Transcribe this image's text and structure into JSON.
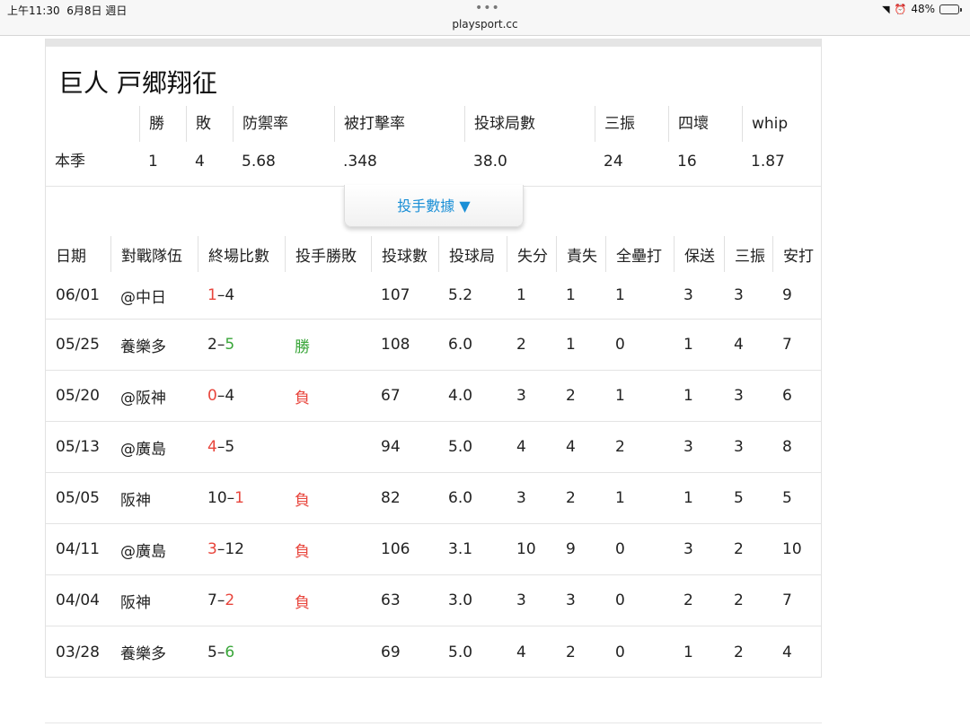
{
  "status_bar": {
    "time": "上午11:30",
    "date": "6月8日 週日",
    "url": "playsport.cc",
    "battery": "48%",
    "battery_level": 0.48
  },
  "player": {
    "title": "巨人 戸郷翔征"
  },
  "season": {
    "headers": [
      "",
      "勝",
      "敗",
      "防禦率",
      "被打擊率",
      "投球局數",
      "三振",
      "四壞",
      "whip"
    ],
    "row": [
      "本季",
      "1",
      "4",
      "5.68",
      ".348",
      "38.0",
      "24",
      "16",
      "1.87"
    ]
  },
  "toggle": {
    "label": "投手數據 ▼"
  },
  "games": {
    "headers": [
      "日期",
      "對戰隊伍",
      "終場比數",
      "投手勝敗",
      "投球數",
      "投球局",
      "失分",
      "責失",
      "全壘打",
      "保送",
      "三振",
      "安打"
    ],
    "rows": [
      {
        "date": "06/01",
        "opp": "@中日",
        "s1": "1",
        "s1c": "red",
        "s2": "4",
        "s2c": "",
        "wl": "",
        "wlc": "",
        "pitches": "107",
        "ip": "5.2",
        "r": "1",
        "er": "1",
        "hr": "1",
        "bb": "3",
        "so": "3",
        "h": "9"
      },
      {
        "date": "05/25",
        "opp": "養樂多",
        "s1": "2",
        "s1c": "",
        "s2": "5",
        "s2c": "green",
        "wl": "勝",
        "wlc": "green",
        "pitches": "108",
        "ip": "6.0",
        "r": "2",
        "er": "1",
        "hr": "0",
        "bb": "1",
        "so": "4",
        "h": "7"
      },
      {
        "date": "05/20",
        "opp": "@阪神",
        "s1": "0",
        "s1c": "red",
        "s2": "4",
        "s2c": "",
        "wl": "負",
        "wlc": "red",
        "pitches": "67",
        "ip": "4.0",
        "r": "3",
        "er": "2",
        "hr": "1",
        "bb": "1",
        "so": "3",
        "h": "6"
      },
      {
        "date": "05/13",
        "opp": "@廣島",
        "s1": "4",
        "s1c": "red",
        "s2": "5",
        "s2c": "",
        "wl": "",
        "wlc": "",
        "pitches": "94",
        "ip": "5.0",
        "r": "4",
        "er": "4",
        "hr": "2",
        "bb": "3",
        "so": "3",
        "h": "8"
      },
      {
        "date": "05/05",
        "opp": "阪神",
        "s1": "10",
        "s1c": "",
        "s2": "1",
        "s2c": "red",
        "wl": "負",
        "wlc": "red",
        "pitches": "82",
        "ip": "6.0",
        "r": "3",
        "er": "2",
        "hr": "1",
        "bb": "1",
        "so": "5",
        "h": "5"
      },
      {
        "date": "04/11",
        "opp": "@廣島",
        "s1": "3",
        "s1c": "red",
        "s2": "12",
        "s2c": "",
        "wl": "負",
        "wlc": "red",
        "pitches": "106",
        "ip": "3.1",
        "r": "10",
        "er": "9",
        "hr": "0",
        "bb": "3",
        "so": "2",
        "h": "10"
      },
      {
        "date": "04/04",
        "opp": "阪神",
        "s1": "7",
        "s1c": "",
        "s2": "2",
        "s2c": "red",
        "wl": "負",
        "wlc": "red",
        "pitches": "63",
        "ip": "3.0",
        "r": "3",
        "er": "3",
        "hr": "0",
        "bb": "2",
        "so": "2",
        "h": "7"
      },
      {
        "date": "03/28",
        "opp": "養樂多",
        "s1": "5",
        "s1c": "",
        "s2": "6",
        "s2c": "green",
        "wl": "",
        "wlc": "",
        "pitches": "69",
        "ip": "5.0",
        "r": "4",
        "er": "2",
        "hr": "0",
        "bb": "1",
        "so": "2",
        "h": "4"
      }
    ]
  }
}
